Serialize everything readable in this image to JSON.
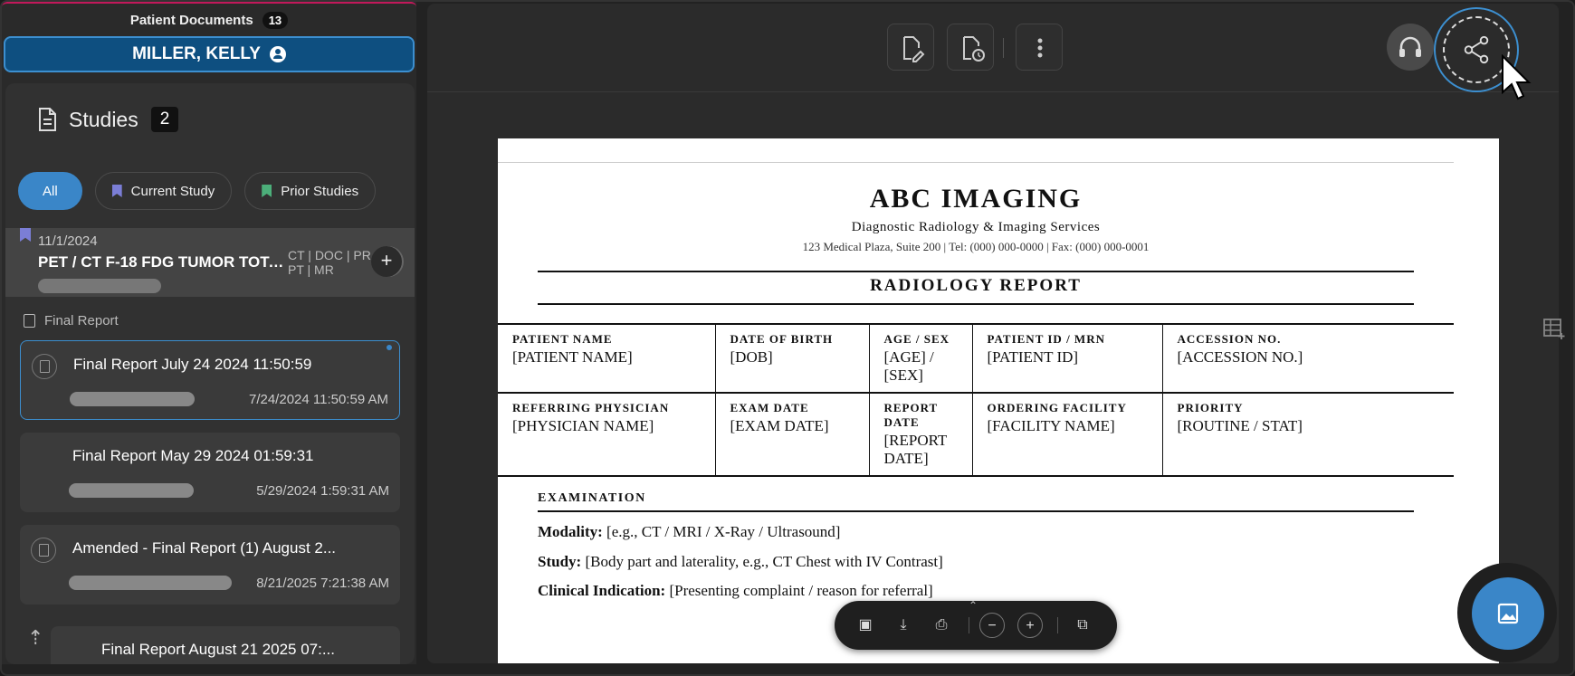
{
  "left_panel": {
    "header": {
      "title": "Patient Documents",
      "count": "13"
    },
    "patient": {
      "name": "MILLER, KELLY"
    },
    "studies": {
      "title": "Studies",
      "count": "2",
      "filters": [
        {
          "label": "All",
          "active": true
        },
        {
          "label": "Current Study",
          "flag_color": "#7b7ed6"
        },
        {
          "label": "Prior Studies",
          "flag_color": "#4caf7a"
        }
      ],
      "study": {
        "date": "11/1/2024",
        "name": "PET / CT F-18 FDG TUMOR TOTA...",
        "modalities": "CT | DOC | PR | PT | MR",
        "add_label": "+"
      },
      "section_label": "Final Report",
      "reports": [
        {
          "title": "Final Report July 24 2024 11:50:59",
          "date": "7/24/2024 11:50:59 AM",
          "selected": true
        },
        {
          "title": "Final Report May 29 2024 01:59:31",
          "date": "5/29/2024 1:59:31 AM"
        },
        {
          "title": "Amended - Final Report (1) August 2...",
          "date": "8/21/2025 7:21:38 AM"
        },
        {
          "title": "Final Report August 21 2025 07:..."
        }
      ]
    }
  },
  "document": {
    "org_name": "ABC IMAGING",
    "org_subtitle": "Diagnostic Radiology & Imaging Services",
    "org_address": "123 Medical Plaza, Suite 200  |  Tel: (000) 000-0000  |  Fax: (000) 000-0001",
    "report_title": "RADIOLOGY REPORT",
    "fields_row1": [
      {
        "label": "PATIENT NAME",
        "value": "[PATIENT NAME]"
      },
      {
        "label": "DATE OF BIRTH",
        "value": "[DOB]"
      },
      {
        "label": "AGE / SEX",
        "value": "[AGE] / [SEX]"
      },
      {
        "label": "PATIENT ID / MRN",
        "value": "[PATIENT ID]"
      },
      {
        "label": "ACCESSION NO.",
        "value": "[ACCESSION NO.]"
      }
    ],
    "fields_row2": [
      {
        "label": "REFERRING PHYSICIAN",
        "value": "[PHYSICIAN NAME]"
      },
      {
        "label": "EXAM DATE",
        "value": "[EXAM DATE]"
      },
      {
        "label": "REPORT DATE",
        "value": "[REPORT DATE]"
      },
      {
        "label": "ORDERING FACILITY",
        "value": "[FACILITY NAME]"
      },
      {
        "label": "PRIORITY",
        "value": "[ROUTINE / STAT]"
      }
    ],
    "exam_section_title": "EXAMINATION",
    "exam_lines": [
      {
        "label": "Modality:",
        "value": "[e.g., CT / MRI / X-Ray / Ultrasound]"
      },
      {
        "label": "Study:",
        "value": "[Body part and laterality, e.g., CT Chest with IV Contrast]"
      },
      {
        "label": "Clinical Indication:",
        "value": "[Presenting complaint / reason for referral]"
      }
    ]
  },
  "toolbar_icons": [
    "edit-document-icon",
    "document-history-icon",
    "more-vertical-icon",
    "headset-icon",
    "share-icon"
  ],
  "viewer_toolbar_icons": [
    "thumbnails-icon",
    "download-icon",
    "print-icon",
    "zoom-out-icon",
    "zoom-in-icon",
    "open-external-icon"
  ],
  "colors": {
    "accent": "#3a86c8",
    "patient_bar": "#0e4f80",
    "current_flag": "#7b7ed6",
    "prior_flag": "#4caf7a"
  }
}
